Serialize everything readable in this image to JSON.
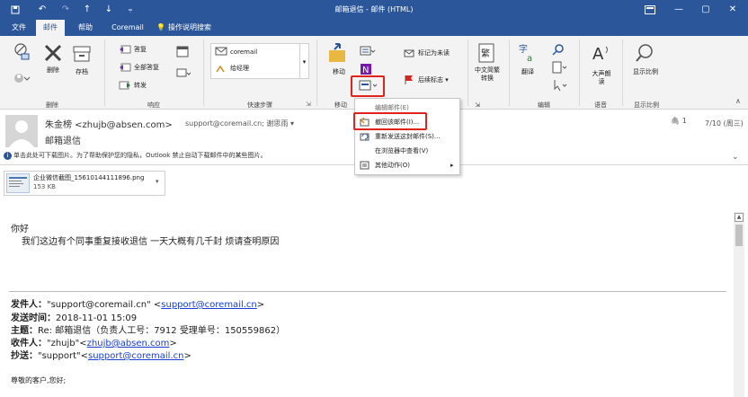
{
  "window": {
    "title": "邮箱退信 - 邮件 (HTML)",
    "quick_access": [
      "save-icon",
      "undo-icon",
      "redo-icon",
      "up-icon",
      "down-icon",
      "customize-icon"
    ]
  },
  "tabs": [
    {
      "label": "文件",
      "active": false
    },
    {
      "label": "邮件",
      "active": true
    },
    {
      "label": "帮助",
      "active": false
    },
    {
      "label": "Coremail",
      "active": false
    },
    {
      "label": "操作说明搜索",
      "active": false
    }
  ],
  "ribbon": {
    "delete_group": {
      "label": "删除",
      "delete": "删除",
      "archive": "存档"
    },
    "respond_group": {
      "label": "响应",
      "reply": "答复",
      "reply_all": "全部答复",
      "forward": "转发"
    },
    "quicksteps_group": {
      "label": "快速步骤",
      "items": [
        "coremail",
        "给经理"
      ]
    },
    "move_group": {
      "label": "移动",
      "move": "移动"
    },
    "tags_group": {
      "label": "标记",
      "mark_unread": "标记为未读",
      "followup": "后续标志"
    },
    "lang_group": {
      "convert": "中文简繁转换"
    },
    "edit_group": {
      "label": "编辑",
      "translate": "翻译"
    },
    "speech_group": {
      "label": "语音",
      "read_aloud": "大声朗读"
    },
    "zoom_group": {
      "label": "显示比例",
      "zoom": "显示比例"
    }
  },
  "context_menu": {
    "items": [
      "编辑邮件(E)",
      "撤回该邮件(I)...",
      "重新发送这封邮件(S)...",
      "在浏览器中查看(V)",
      "其他动作(O)"
    ]
  },
  "message": {
    "sender": "朱金榜 <zhujb@absen.com>",
    "recipients": "support@coremail.cn; 谢思雨",
    "subject": "邮箱退信",
    "attachment_count": "1",
    "date": "7/10 (周三)",
    "warning": "单击此处可下载图片。为了帮助保护您的隐私，Outlook 禁止自动下载邮件中的某些图片。",
    "attachment": {
      "name": "企业微信截图_15610144111896.png",
      "size": "153 KB"
    }
  },
  "body": {
    "greeting": "你好",
    "line1": "我们这边有个同事重复接收退信 一天大概有几千封 烦请查明原因",
    "from_label": "发件人：",
    "from_name": "\"support@coremail.cn\"",
    "from_email": "support@coremail.cn",
    "sent_label": "发送时间：",
    "sent": "2018-11-01 15:09",
    "subject_label": "主题：",
    "subject": "Re: 邮箱退信（负责人工号：7912 受理单号：150559862）",
    "to_label": "收件人：",
    "to_name": "\"zhujb\"",
    "to_email": "zhujb@absen.com",
    "cc_label": "抄送：",
    "cc_name": "\"support\"",
    "cc_email": "support@coremail.cn",
    "closing": "尊敬的客户,您好;"
  },
  "colors": {
    "accent": "#2b579a",
    "highlight_border": "#e0241d",
    "link": "#1a3ed8"
  }
}
